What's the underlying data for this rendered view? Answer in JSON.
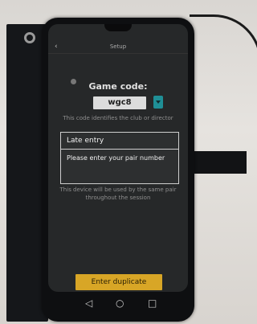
{
  "status_bar": {
    "left": "",
    "right": ""
  },
  "app": {
    "name": "",
    "screen_title": "Setup"
  },
  "game_code": {
    "label": "Game code:",
    "value": "wgc8",
    "help": "This code identifies the club or director"
  },
  "dialog": {
    "title": "Late entry",
    "message": "Please enter your pair number"
  },
  "device_note": "This device will be used by the same pair throughout the session",
  "enter_button_label": "Enter duplicate",
  "icons": {
    "back": "back-arrow-icon",
    "dropdown": "chevron-down-icon",
    "nav_back": "triangle-back-icon",
    "nav_home": "circle-home-icon",
    "nav_recent": "square-recents-icon"
  },
  "colors": {
    "accent_button": "#d8a626",
    "dropdown_button": "#1f8f96",
    "screen_background": "#262829"
  }
}
